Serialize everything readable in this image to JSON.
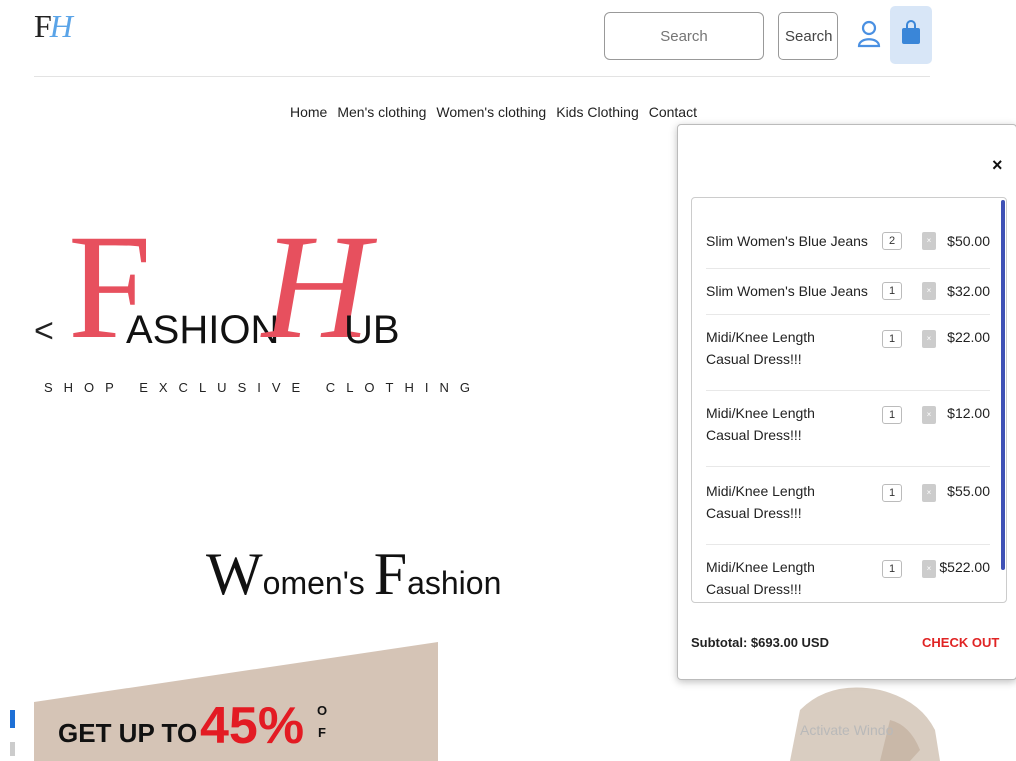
{
  "header": {
    "logo": {
      "f": "F",
      "h": "H"
    },
    "search": {
      "placeholder": "Search",
      "button_label": "Search"
    },
    "icons": {
      "user": "user-icon",
      "bag": "shopping-bag-icon"
    },
    "accent_color": "#5aa4e8"
  },
  "nav": {
    "items": [
      {
        "label": "Home"
      },
      {
        "label": "Men's clothing"
      },
      {
        "label": "Women's clothing"
      },
      {
        "label": "Kids Clothing"
      },
      {
        "label": "Contact"
      }
    ]
  },
  "hero": {
    "prev_arrow": "<",
    "brand": {
      "f": "F",
      "ashion": "ASHION",
      "h": "H",
      "ub": "UB",
      "color": "#e7505e"
    },
    "tagline": "SHOP EXCLUSIVE CLOTHING"
  },
  "section": {
    "title_w": "W",
    "title_omen": "omen's ",
    "title_f": "F",
    "title_ashion": "ashion"
  },
  "promo": {
    "text": "GET UP TO",
    "percent": "45%",
    "side": [
      "O",
      "F"
    ],
    "bg_color": "#d5c4b6",
    "pct_color": "#e31b23"
  },
  "watermark": "Activate Windo",
  "cart": {
    "close_label": "×",
    "items": [
      {
        "name": "Slim Women's Blue Jeans",
        "qty": "2",
        "remove": "×",
        "price": "$50.00"
      },
      {
        "name": "Slim Women's Blue Jeans",
        "qty": "1",
        "remove": "×",
        "price": "$32.00"
      },
      {
        "name": "Midi/Knee Length Casual Dress!!!",
        "qty": "1",
        "remove": "×",
        "price": "$22.00"
      },
      {
        "name": "Midi/Knee Length Casual Dress!!!",
        "qty": "1",
        "remove": "×",
        "price": "$12.00"
      },
      {
        "name": "Midi/Knee Length Casual Dress!!!",
        "qty": "1",
        "remove": "×",
        "price": "$55.00"
      },
      {
        "name": "Midi/Knee Length Casual Dress!!!",
        "qty": "1",
        "remove": "×",
        "price": "$522.00"
      }
    ],
    "subtotal": "Subtotal: $693.00 USD",
    "checkout_label": "CHECK OUT",
    "checkout_color": "#e02424",
    "scrollbar_color": "#3f51b5"
  }
}
